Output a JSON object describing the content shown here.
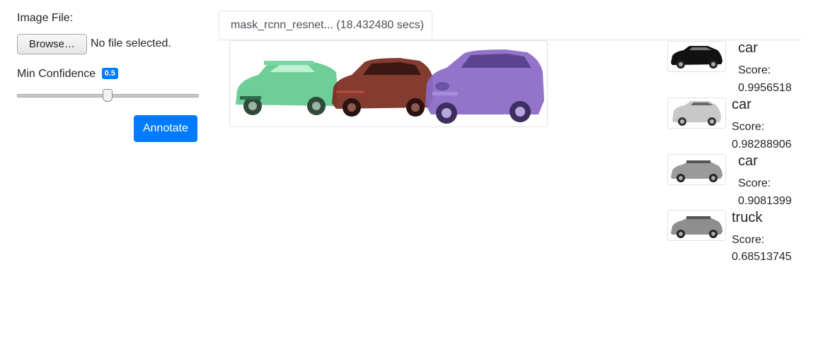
{
  "sidebar": {
    "image_file_label": "Image File:",
    "browse_label": "Browse…",
    "no_file_text": "No file selected.",
    "min_confidence_label": "Min Confidence",
    "min_confidence_value": "0.5",
    "slider_value": 0.5,
    "annotate_label": "Annotate"
  },
  "tabs": [
    {
      "label": "mask_rcnn_resnet... (18.432480 secs)"
    }
  ],
  "colors": {
    "primary": "#007bff",
    "mask_green": "#5ec98c",
    "mask_maroon": "#7a2a1e",
    "mask_purple": "#8a6bc6"
  },
  "detections": [
    {
      "label": "car",
      "score_label": "Score:",
      "score": "0.9956518"
    },
    {
      "label": "car",
      "score_label": "Score:",
      "score": "0.98288906"
    },
    {
      "label": "car",
      "score_label": "Score:",
      "score": "0.9081399"
    },
    {
      "label": "truck",
      "score_label": "Score:",
      "score": "0.68513745"
    }
  ]
}
